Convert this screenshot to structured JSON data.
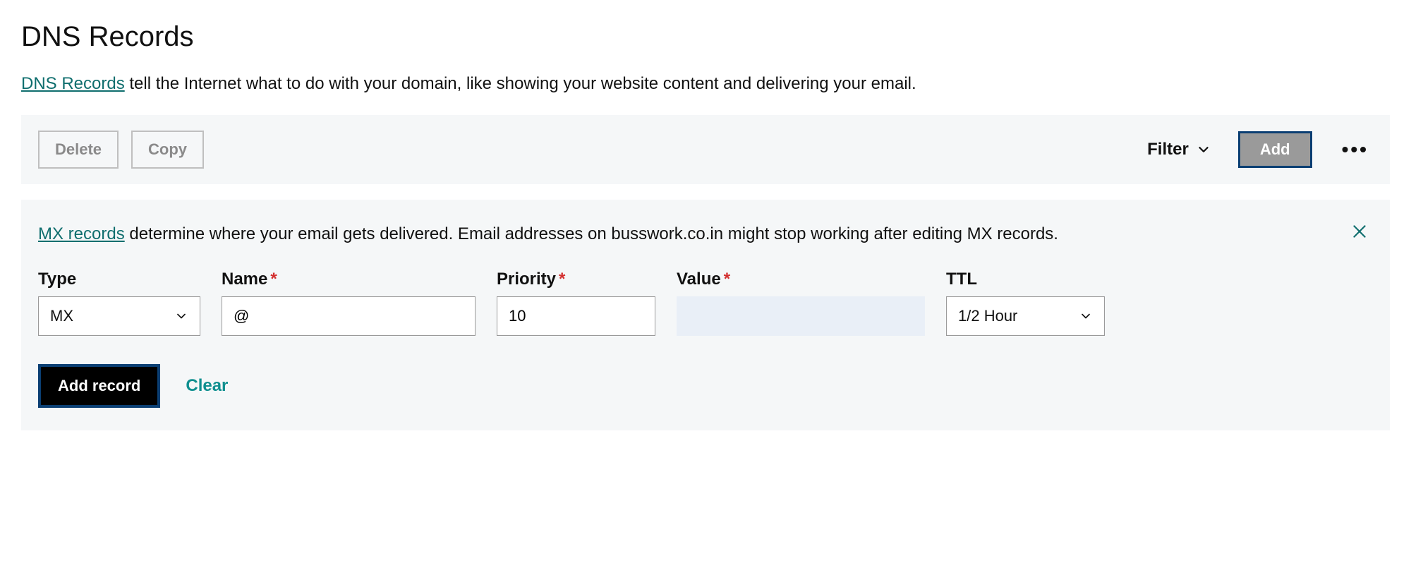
{
  "page": {
    "title": "DNS Records",
    "desc_link": "DNS Records",
    "desc_rest": " tell the Internet what to do with your domain, like showing your website content and delivering your email."
  },
  "toolbar": {
    "delete": "Delete",
    "copy": "Copy",
    "filter": "Filter",
    "add": "Add"
  },
  "notice": {
    "link": "MX records",
    "rest": " determine where your email gets delivered. Email addresses on busswork.co.in might stop working after editing MX records."
  },
  "fields": {
    "type": {
      "label": "Type",
      "value": "MX"
    },
    "name": {
      "label": "Name",
      "value": "@"
    },
    "priority": {
      "label": "Priority",
      "value": "10"
    },
    "value": {
      "label": "Value",
      "value": ""
    },
    "ttl": {
      "label": "TTL",
      "value": "1/2 Hour"
    }
  },
  "actions": {
    "add_record": "Add record",
    "clear": "Clear"
  }
}
